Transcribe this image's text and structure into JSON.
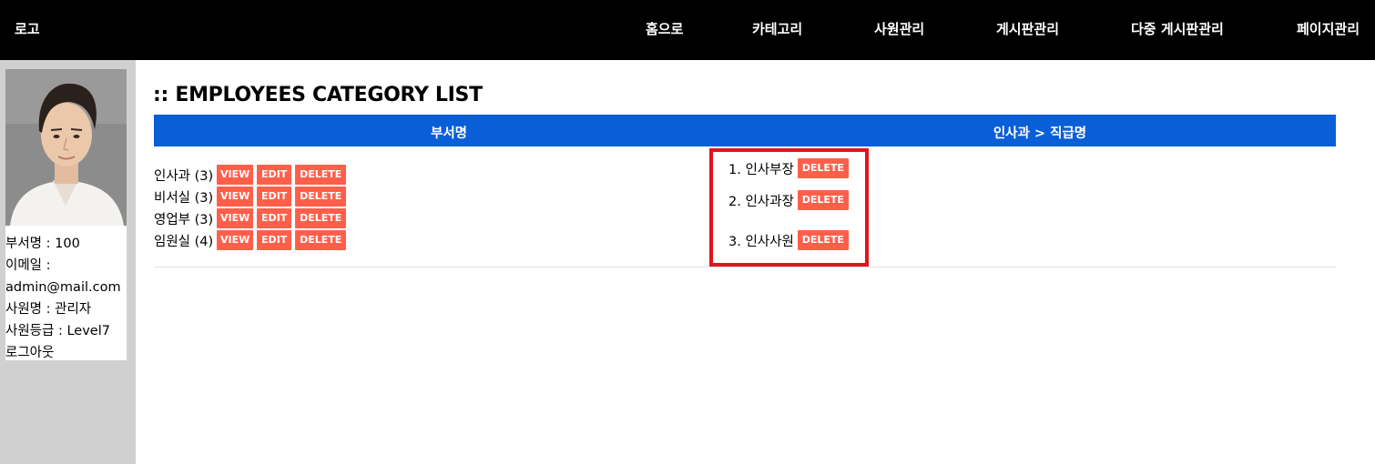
{
  "header": {
    "logo": "로고",
    "nav": [
      "홈으로",
      "카테고리",
      "사원관리",
      "게시판관리",
      "다중 게시판관리",
      "페이지관리"
    ]
  },
  "profile": {
    "dept_line": "부서명 : 100",
    "email_label": "이메일 :",
    "email_value": "admin@mail.com",
    "name_line": "사원명 : 관리자",
    "grade_line": "사원등급 : Level7",
    "logout": "로그아웃"
  },
  "main": {
    "title": ":: EMPLOYEES CATEGORY LIST",
    "col_left": "부서명",
    "col_right": "인사과 > 직급명",
    "departments": [
      {
        "label": "인사과 (3)"
      },
      {
        "label": "비서실 (3)"
      },
      {
        "label": "영업부 (3)"
      },
      {
        "label": "임원실 (4)"
      }
    ],
    "buttons": {
      "view": "VIEW",
      "edit": "EDIT",
      "delete": "DELETE"
    },
    "positions": [
      {
        "label": "1. 인사부장"
      },
      {
        "label": "2. 인사과장"
      },
      {
        "label": "3. 인사사원"
      }
    ]
  },
  "colors": {
    "topbar": "#000000",
    "sidebar": "#d0d0d0",
    "header_accent": "#0a5ed7",
    "button": "#ff5f4a",
    "highlight": "#e0141e"
  }
}
